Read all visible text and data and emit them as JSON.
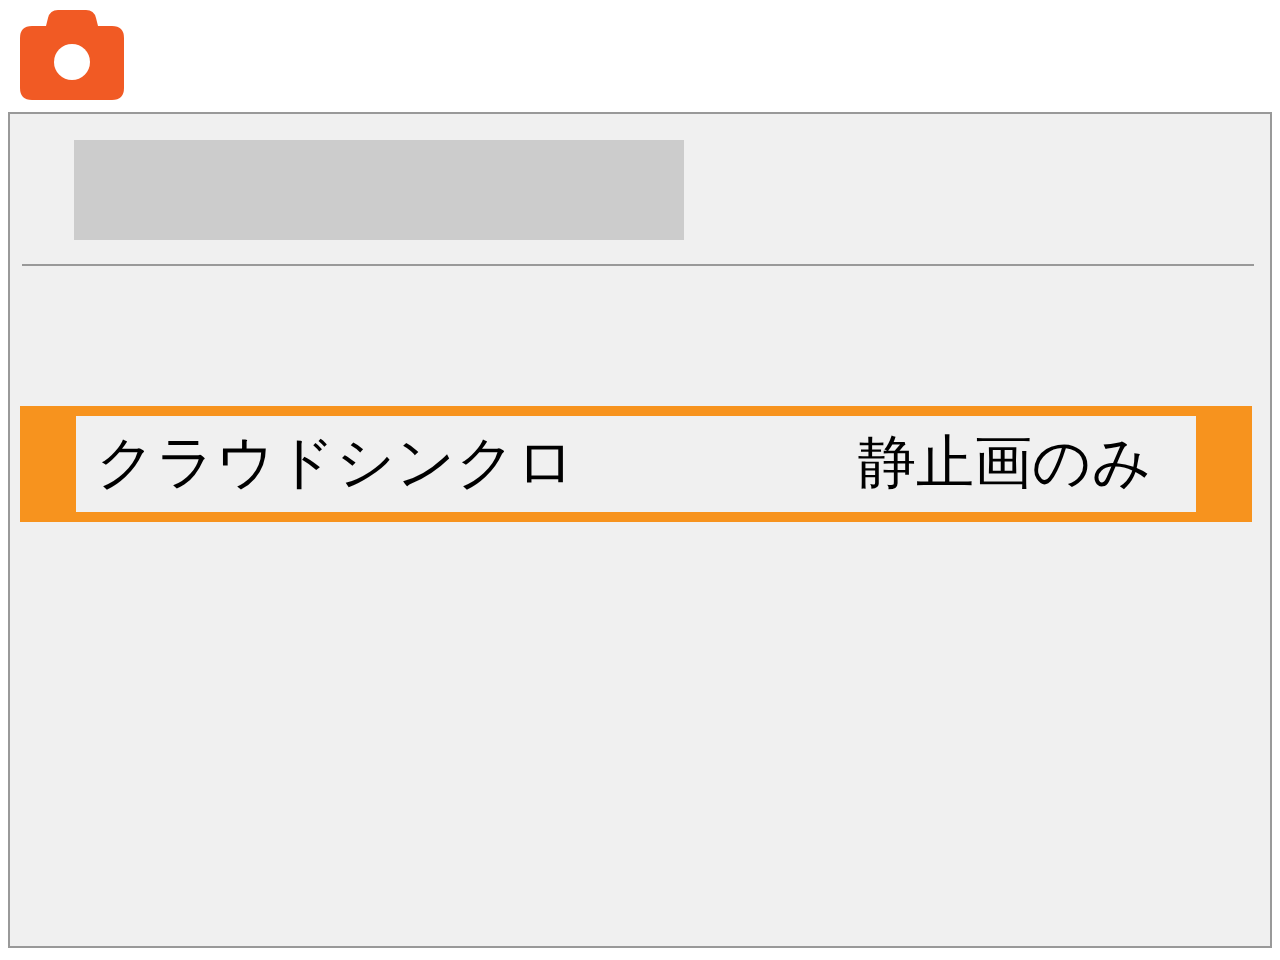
{
  "menu": {
    "items": [
      {
        "label": "クラウドシンクロ",
        "value": "静止画のみ",
        "selected": true
      }
    ]
  }
}
